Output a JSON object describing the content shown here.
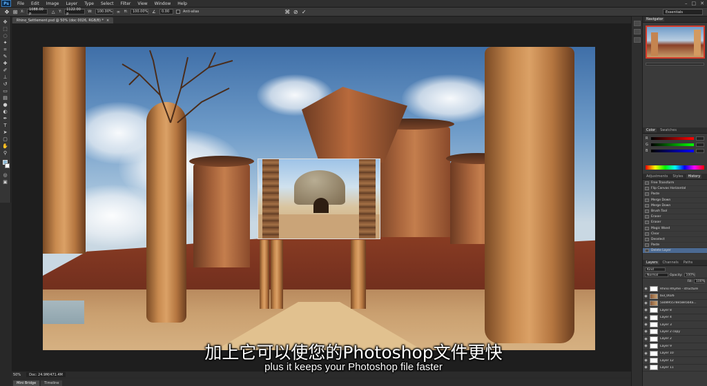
{
  "app": {
    "logo": "Ps"
  },
  "menu": [
    "File",
    "Edit",
    "Image",
    "Layer",
    "Type",
    "Select",
    "Filter",
    "View",
    "Window",
    "Help"
  ],
  "options": {
    "x_label": "X:",
    "x_value": "1088.00 p",
    "y_label": "Y:",
    "y_value": "1122.00 p",
    "w_label": "W:",
    "w_value": "100.00%",
    "h_label": "H:",
    "h_value": "100.00%",
    "angle_value": "0.00",
    "antialias_label": "Anti-alias",
    "workspace": "Essentials"
  },
  "document": {
    "tab_title": "Rhino_Settlement.psd @ 50% (doc 0026, RGB/8) *",
    "zoom": "50%",
    "doc_size": "Doc: 24.9M/471.4M"
  },
  "panels": {
    "navigator_tab": "Navigator",
    "color_tabs": [
      "Color",
      "Swatches"
    ],
    "color_channels": [
      "R",
      "G",
      "B"
    ],
    "adjust_tabs": [
      "Adjustments",
      "Styles",
      "History"
    ],
    "history": [
      "Free Transform",
      "Flip Canvas Horizontal",
      "Paste",
      "Merge Down",
      "Merge Down",
      "Brush Tool",
      "Eraser",
      "Eraser",
      "Magic Wand",
      "Clear",
      "Deselect",
      "Paste",
      "Delete Layer"
    ],
    "layers_tabs": [
      "Layers",
      "Channels",
      "Paths"
    ],
    "blend_mode": "Normal",
    "opacity_label": "Opacity:",
    "opacity_value": "100%",
    "fill_label": "Fill:",
    "fill_value": "100%",
    "kind_label": "Kind",
    "layers": [
      "Rhino Rhyme - structure",
      "bul_0026",
      "5a0895578e58e5b4a...",
      "Layer 8",
      "Layer 4",
      "Layer 3",
      "Layer 2 copy",
      "Layer 2",
      "Layer 9",
      "Layer 10",
      "Layer 12",
      "Layer 11"
    ]
  },
  "bottom_tabs": [
    "Mini Bridge",
    "Timeline"
  ],
  "subtitles": {
    "cn": "加上它可以使您的Photoshop文件更快",
    "en": "plus it keeps your Photoshop file faster"
  }
}
